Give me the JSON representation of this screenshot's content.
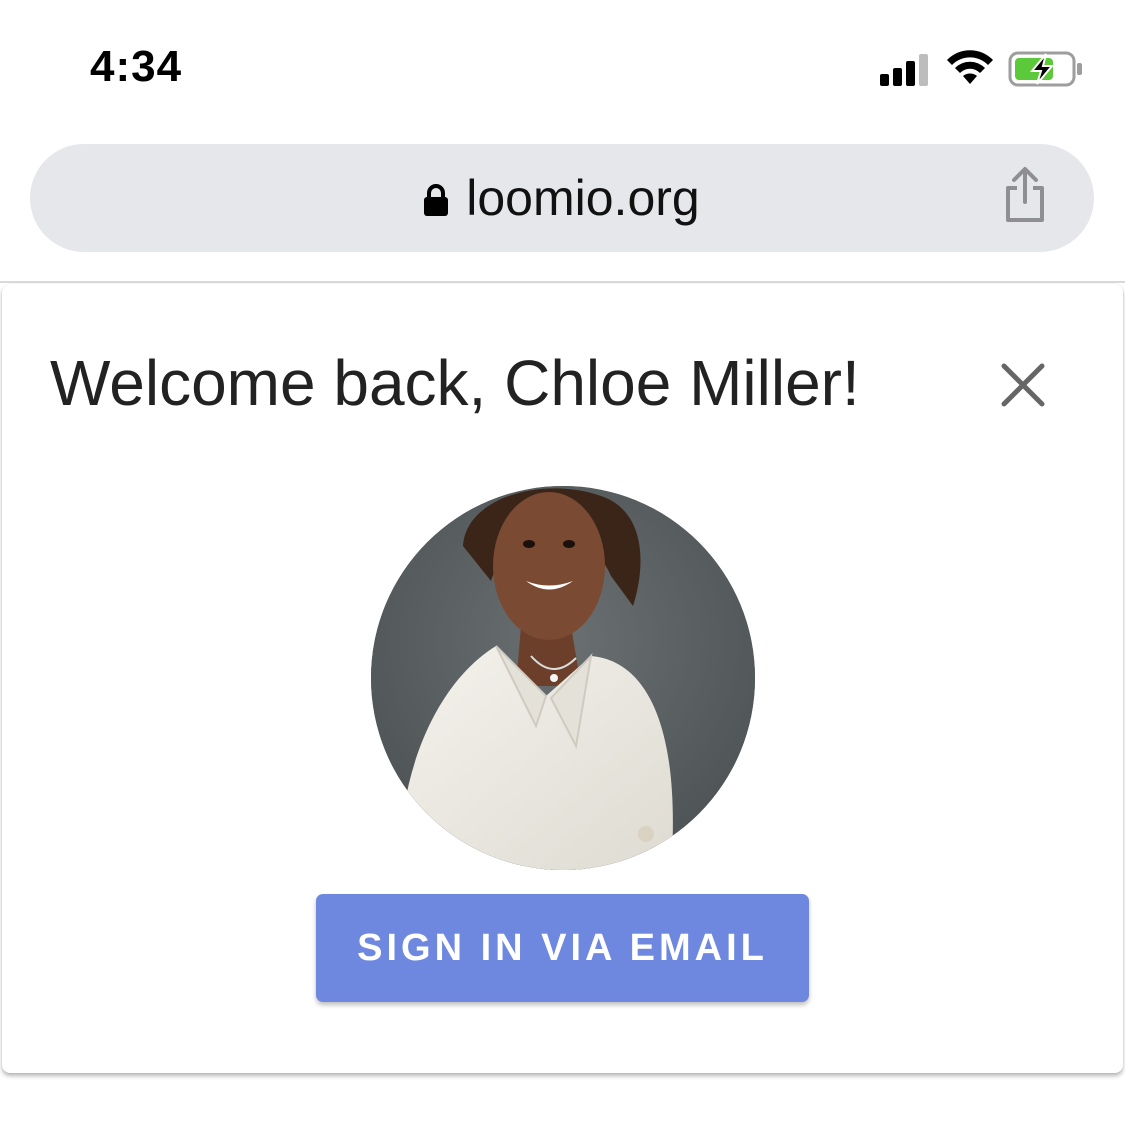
{
  "status_bar": {
    "time": "4:34",
    "signal_icon": "cellular-signal-icon",
    "wifi_icon": "wifi-icon",
    "battery_icon": "battery-charging-icon",
    "battery_color": "#5cc93a"
  },
  "browser": {
    "url": "loomio.org",
    "lock_icon": "lock-icon",
    "share_icon": "share-icon"
  },
  "modal": {
    "title": "Welcome back, Chloe Miller!",
    "close_icon": "close-icon",
    "avatar_alt": "user-avatar",
    "signin_button_label": "SIGN IN VIA EMAIL",
    "accent_color": "#6e88e0"
  }
}
